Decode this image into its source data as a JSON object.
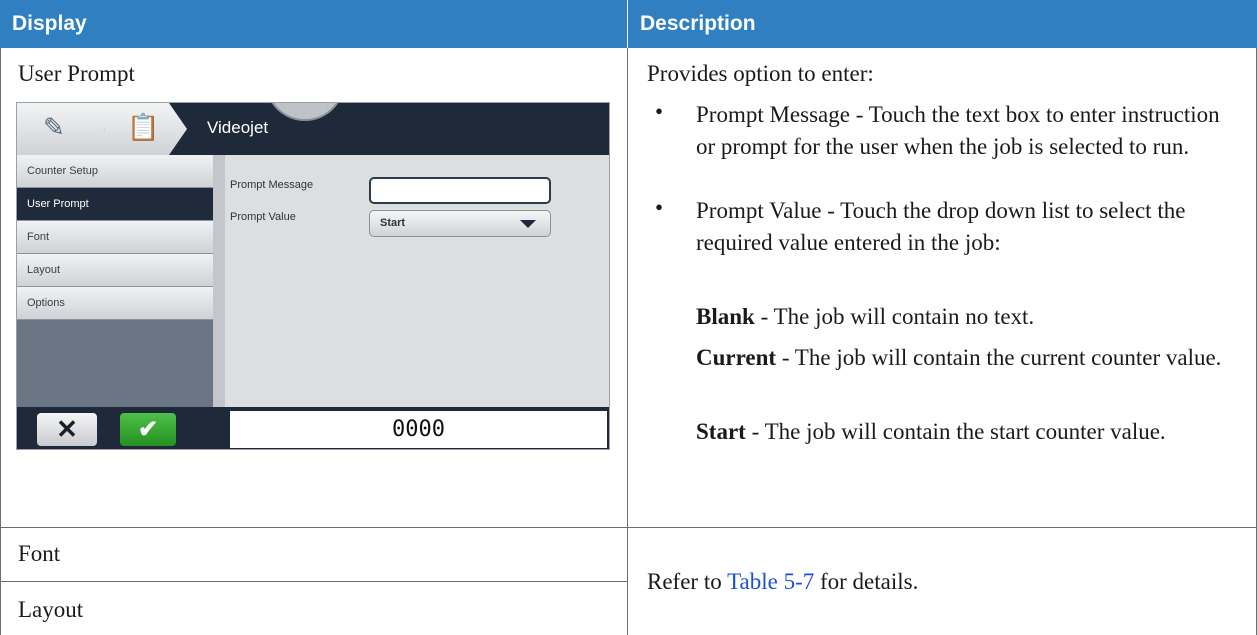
{
  "header": {
    "col1": "Display",
    "col2": "Description"
  },
  "row1": {
    "display_label": "User Prompt",
    "device": {
      "title": "Videojet",
      "sidebar": [
        {
          "label": "Counter Setup"
        },
        {
          "label": "User Prompt"
        },
        {
          "label": "Font"
        },
        {
          "label": "Layout"
        },
        {
          "label": "Options"
        }
      ],
      "active_index": 1,
      "prompt_message_label": "Prompt Message",
      "prompt_message_value": "",
      "prompt_value_label": "Prompt Value",
      "prompt_value_selected": "Start",
      "counter_value": "0000",
      "icons": [
        "edit-icon",
        "clipboard-icon",
        "close-icon",
        "check-icon",
        "chevron-down-icon"
      ]
    },
    "description": {
      "intro": "Provides option to enter:",
      "bullet1": {
        "title": "Prompt Message",
        "rest": " - Touch the text box to enter instruction or prompt for the user when the job is selected to run."
      },
      "bullet2": {
        "title": "Prompt Value",
        "rest": " - Touch the drop down list to select the required value entered in the job:"
      },
      "option1": {
        "term": "Blank",
        "text": " - The job will contain no text."
      },
      "option2": {
        "term": "Current",
        "text": " - The job will contain the current counter value."
      },
      "option3": {
        "term": "Start",
        "text": " - The job will contain the start counter value."
      }
    }
  },
  "row2": {
    "display_label": "Font"
  },
  "row3": {
    "display_label": "Layout"
  },
  "shared_description": {
    "prefix": "Refer to ",
    "link": "Table 5-7",
    "suffix": " for details."
  },
  "colors": {
    "header_bg": "#2f7fc1",
    "link": "#1f4fd1",
    "device_dark": "#1e2a3a",
    "ok_green": "#2e9b2a"
  }
}
